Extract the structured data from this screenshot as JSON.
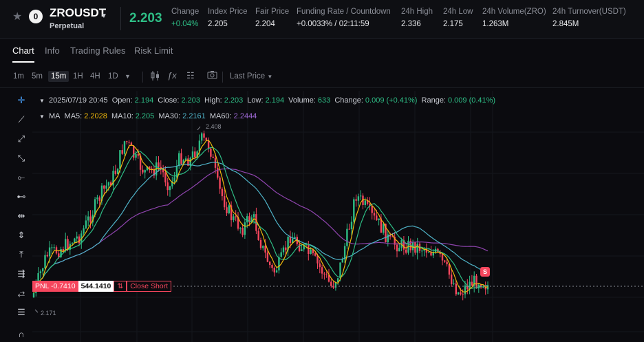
{
  "header": {
    "symbol": "ZROUSDT",
    "contract_type": "Perpetual",
    "last_price": "2.203",
    "stats": [
      {
        "label": "Change",
        "value": "+0.04%",
        "green": true
      },
      {
        "label": "Index Price",
        "value": "2.205"
      },
      {
        "label": "Fair Price",
        "value": "2.204"
      },
      {
        "label": "Funding Rate / Countdown",
        "value": "+0.0033% / 02:11:59"
      },
      {
        "label": "24h High",
        "value": "2.336"
      },
      {
        "label": "24h Low",
        "value": "2.175"
      },
      {
        "label": "24h Volume(ZRO)",
        "value": "1.263M"
      },
      {
        "label": "24h Turnover(USDT)",
        "value": "2.845M"
      }
    ]
  },
  "tabs": [
    "Chart",
    "Info",
    "Trading Rules",
    "Risk Limit"
  ],
  "toolbar": {
    "timeframes": [
      "1m",
      "5m",
      "15m",
      "1H",
      "4H",
      "1D"
    ],
    "active_timeframe": "15m",
    "price_type": "Last Price"
  },
  "legend": {
    "date": "2025/07/19 20:45",
    "open_label": "Open:",
    "open": "2.194",
    "close_label": "Close:",
    "close": "2.203",
    "high_label": "High:",
    "high": "2.203",
    "low_label": "Low:",
    "low": "2.194",
    "volume_label": "Volume:",
    "volume": "633",
    "change_label": "Change:",
    "change": "0.009 (+0.41%)",
    "range_label": "Range:",
    "range": "0.009 (0.41%)",
    "ma_title": "MA",
    "ma5_label": "MA5:",
    "ma5": "2.2028",
    "ma10_label": "MA10:",
    "ma10": "2.205",
    "ma30_label": "MA30:",
    "ma30": "2.2161",
    "ma60_label": "MA60:",
    "ma60": "2.2444"
  },
  "chart": {
    "high_marker": "2.408",
    "low_marker": "2.171",
    "pnl_label": "PNL -0.7410",
    "position_qty": "544.1410",
    "close_label": "Close Short",
    "side_badge": "S",
    "colors": {
      "up": "#2ebd85",
      "down": "#f6465d",
      "ma5": "#f0b90b",
      "ma10": "#2ebd85",
      "ma30": "#4fb3c8",
      "ma60": "#8e44ad"
    }
  }
}
